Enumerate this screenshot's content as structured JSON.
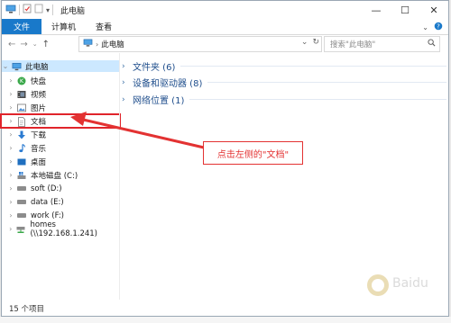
{
  "window": {
    "title": "此电脑"
  },
  "ribbon": {
    "tabs": [
      "文件",
      "计算机",
      "查看"
    ]
  },
  "address": {
    "crumb": "此电脑",
    "search_placeholder": "搜索\"此电脑\""
  },
  "nav_tree": [
    {
      "label": "此电脑",
      "icon": "computer-icon",
      "level": 0
    },
    {
      "label": "快盘",
      "icon": "kuaipan-icon",
      "level": 1
    },
    {
      "label": "视频",
      "icon": "video-folder-icon",
      "level": 1
    },
    {
      "label": "图片",
      "icon": "pictures-folder-icon",
      "level": 1
    },
    {
      "label": "文档",
      "icon": "documents-folder-icon",
      "level": 1
    },
    {
      "label": "下载",
      "icon": "download-folder-icon",
      "level": 1
    },
    {
      "label": "音乐",
      "icon": "music-folder-icon",
      "level": 1
    },
    {
      "label": "桌面",
      "icon": "desktop-folder-icon",
      "level": 1
    },
    {
      "label": "本地磁盘 (C:)",
      "icon": "windows-drive-icon",
      "level": 1
    },
    {
      "label": "soft (D:)",
      "icon": "drive-icon",
      "level": 1
    },
    {
      "label": "data (E:)",
      "icon": "drive-icon",
      "level": 1
    },
    {
      "label": "work (F:)",
      "icon": "drive-icon",
      "level": 1
    },
    {
      "label": "homes (\\\\192.168.1.241)",
      "icon": "network-drive-icon",
      "level": 1
    }
  ],
  "groups": [
    {
      "label": "文件夹 (6)"
    },
    {
      "label": "设备和驱动器 (8)"
    },
    {
      "label": "网络位置 (1)"
    }
  ],
  "status": {
    "item_count": "15 个项目"
  },
  "annotation": {
    "text": "点击左侧的\"文档\""
  },
  "colors": {
    "accent": "#1979ca",
    "selection": "#cce8ff",
    "annotation": "#e33232"
  }
}
